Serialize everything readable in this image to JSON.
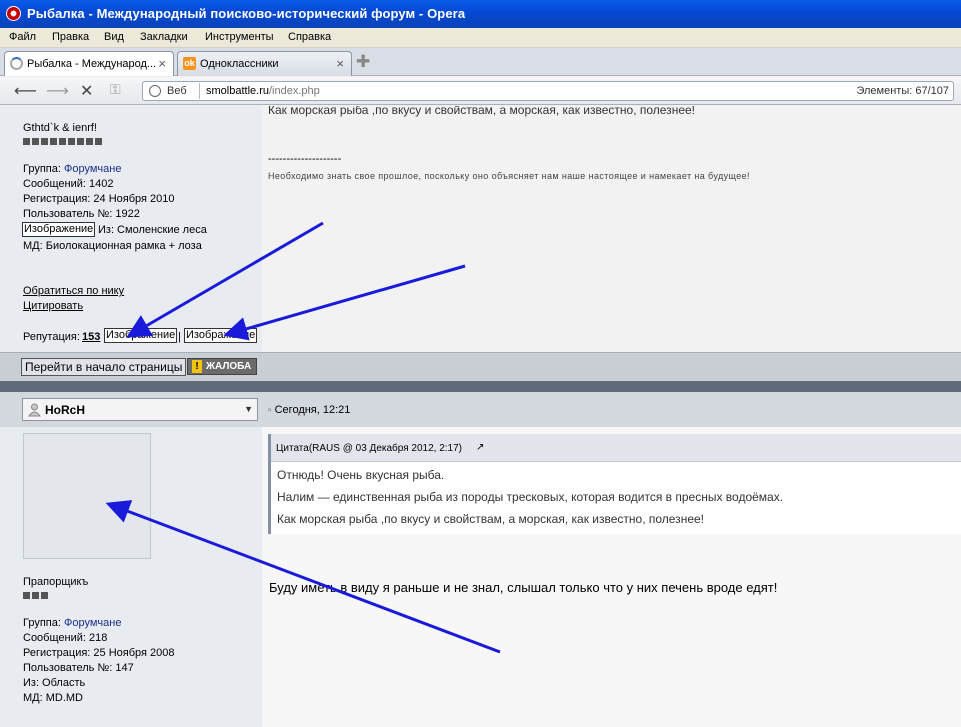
{
  "window": {
    "title": "Рыбалка - Международный поисково-исторический форум - Opera"
  },
  "menu": [
    "Файл",
    "Правка",
    "Вид",
    "Закладки",
    "Инструменты",
    "Справка"
  ],
  "tabs": [
    {
      "label": "Рыбалка - Международ...",
      "active": true
    },
    {
      "label": "Одноклассники",
      "active": false
    }
  ],
  "address": {
    "scheme_label": "Веб",
    "host": "smolbattle.ru",
    "path": "/index.php",
    "elements": "Элементы:   67/107"
  },
  "post1": {
    "text_top": "Как морская рыба ,по вкусу и свойствам, а морская, как известно, полезнее!",
    "sig_line": "--------------------",
    "signature": "Необходимо знать свое прошлое, поскольку оно объясняет нам наше настоящее и намекает на будущее!",
    "user": {
      "rank": "Gthtd`k & ienrf!",
      "group_label": "Группа:",
      "group": "Форумчане",
      "messages": "Сообщений: 1402",
      "registered": "Регистрация: 24 Ноября 2010",
      "user_no": "Пользователь №: 1922",
      "image_label": "Изображение",
      "from": "Из: Смоленские леса",
      "md": "МД: Биолокационная рамка + лоза",
      "reply_nick": "Обратиться по нику",
      "quote": "Цитировать",
      "reputation_label": "Репутация:",
      "reputation": "153",
      "rep_img1": "Изображение",
      "rep_sep": "|",
      "rep_img2": "Изображение"
    }
  },
  "bar": {
    "go_top": "Перейти в начало страницы",
    "complain": "ЖАЛОБА"
  },
  "post2": {
    "username": "HoRcH",
    "date": "Сегодня, 12:21",
    "quote_header": "Цитата(RAUS @ 03 Декабря 2012, 2:17)",
    "quote_lines": [
      "Отнюдь! Очень вкусная рыба.",
      "Налим — единственная рыба из породы тресковых, которая водится в пресных водоёмах.",
      "Как морская рыба ,по вкусу и свойствам, а морская, как известно, полезнее!"
    ],
    "text": "Буду иметь в виду я раньше и не знал, слышал только что у них печень вроде едят!",
    "user": {
      "rank": "Прапорщикъ",
      "group_label": "Группа:",
      "group": "Форумчане",
      "messages": "Сообщений: 218",
      "registered": "Регистрация: 25 Ноября 2008",
      "user_no": "Пользователь №: 147",
      "from": "Из: Область",
      "md": "МД: MD.MD"
    }
  },
  "colors": {
    "arrow": "#1a1adb",
    "titlebar": "#0a5ce6"
  }
}
